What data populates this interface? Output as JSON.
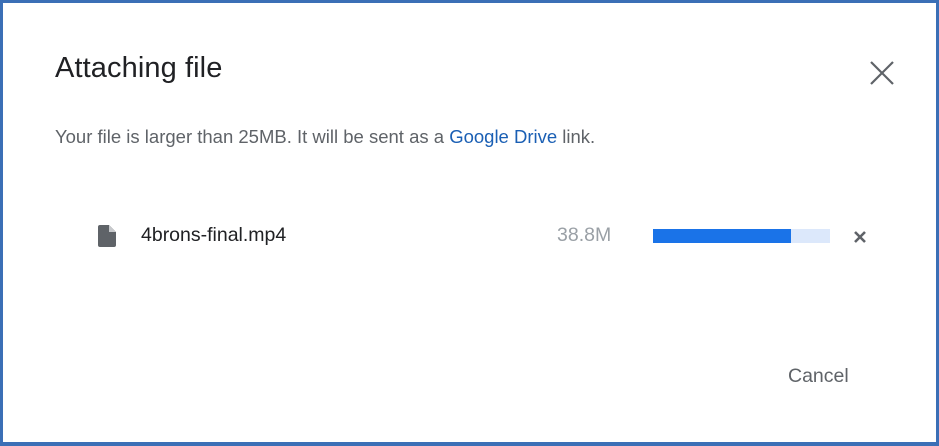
{
  "dialog": {
    "title": "Attaching file",
    "message_prefix": "Your file is larger than 25MB. It will be sent as a ",
    "message_link": "Google Drive",
    "message_suffix": " link.",
    "close_icon": "close-icon",
    "cancel_label": "Cancel"
  },
  "file": {
    "icon": "file-icon",
    "name": "4brons-final.mp4",
    "size": "38.8M",
    "progress_percent": 78,
    "remove_icon": "remove-icon"
  },
  "colors": {
    "accent": "#1a73e8",
    "link": "#1a5fb4",
    "progress_track": "#dce8fb",
    "frame_border": "#3b6fb6"
  }
}
